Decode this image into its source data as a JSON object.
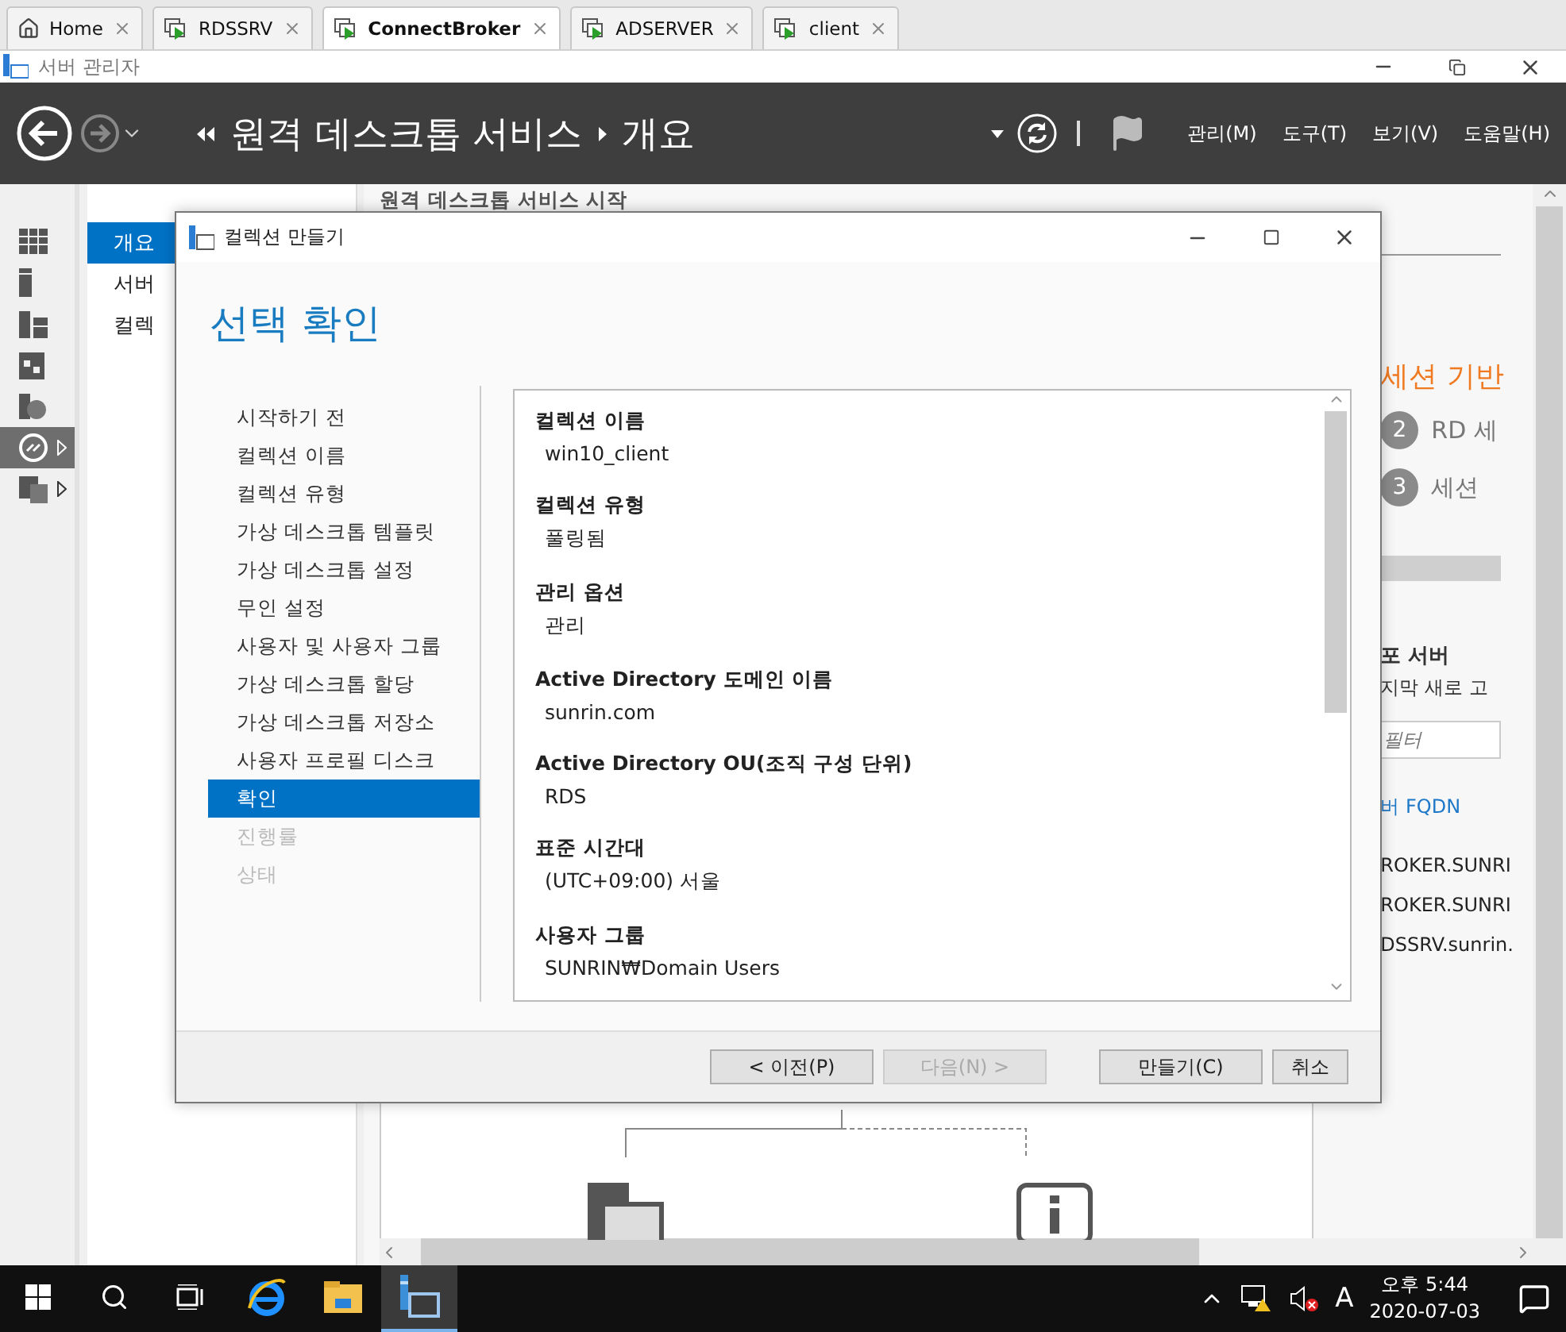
{
  "browser_tabs": [
    {
      "label": "Home",
      "kind": "home",
      "selected": false
    },
    {
      "label": "RDSSRV",
      "kind": "vm",
      "selected": false
    },
    {
      "label": "ConnectBroker",
      "kind": "vm",
      "selected": true
    },
    {
      "label": "ADSERVER",
      "kind": "vm",
      "selected": false
    },
    {
      "label": "client",
      "kind": "vm",
      "selected": false
    }
  ],
  "window": {
    "title": "서버 관리자"
  },
  "header": {
    "breadcrumb": [
      "원격 데스크톱 서비스",
      "개요"
    ],
    "menus": [
      "관리(M)",
      "도구(T)",
      "보기(V)",
      "도움말(H)"
    ]
  },
  "icon_rail": [
    {
      "kind": "dashboard",
      "selected": false,
      "expandable": false
    },
    {
      "kind": "server",
      "selected": false,
      "expandable": false
    },
    {
      "kind": "servers",
      "selected": false,
      "expandable": false
    },
    {
      "kind": "building",
      "selected": false,
      "expandable": false
    },
    {
      "kind": "web",
      "selected": false,
      "expandable": false
    },
    {
      "kind": "remote",
      "selected": true,
      "expandable": true
    },
    {
      "kind": "storage",
      "selected": false,
      "expandable": true
    }
  ],
  "nav": [
    {
      "label": "개요",
      "selected": true
    },
    {
      "label": "서버",
      "selected": false
    },
    {
      "label": "컬렉",
      "selected": false
    }
  ],
  "content": {
    "heading": "원격 데스크톱 서비스 시작",
    "deployment_title": "세션 기반",
    "steps": [
      {
        "number": "2",
        "label": "RD 세"
      },
      {
        "number": "3",
        "label": "세션"
      }
    ],
    "servers_title": "포 서버",
    "servers_subtitle": "지막 새로 고",
    "filter_placeholder": "필터",
    "column": "버 FQDN",
    "rows": [
      "ROKER.SUNRI",
      "ROKER.SUNRI",
      "DSSRV.sunrin."
    ]
  },
  "dialog": {
    "title": "컬렉션 만들기",
    "heading": "선택 확인",
    "steps": [
      {
        "label": "시작하기 전",
        "selected": false,
        "disabled": false
      },
      {
        "label": "컬렉션 이름",
        "selected": false,
        "disabled": false
      },
      {
        "label": "컬렉션 유형",
        "selected": false,
        "disabled": false
      },
      {
        "label": "가상 데스크톱 템플릿",
        "selected": false,
        "disabled": false
      },
      {
        "label": "가상 데스크톱 설정",
        "selected": false,
        "disabled": false
      },
      {
        "label": "무인 설정",
        "selected": false,
        "disabled": false
      },
      {
        "label": "사용자 및 사용자 그룹",
        "selected": false,
        "disabled": false
      },
      {
        "label": "가상 데스크톱 할당",
        "selected": false,
        "disabled": false
      },
      {
        "label": "가상 데스크톱 저장소",
        "selected": false,
        "disabled": false
      },
      {
        "label": "사용자 프로필 디스크",
        "selected": false,
        "disabled": false
      },
      {
        "label": "확인",
        "selected": true,
        "disabled": false
      },
      {
        "label": "진행률",
        "selected": false,
        "disabled": true
      },
      {
        "label": "상태",
        "selected": false,
        "disabled": true
      }
    ],
    "summary": [
      {
        "label": "컬렉션 이름",
        "value": "win10_client"
      },
      {
        "label": "컬렉션 유형",
        "value": "풀링됨"
      },
      {
        "label": "관리 옵션",
        "value": "관리"
      },
      {
        "label": "Active Directory 도메인 이름",
        "value": "sunrin.com"
      },
      {
        "label": "Active Directory OU(조직 구성 단위)",
        "value": "RDS"
      },
      {
        "label": "표준 시간대",
        "value": "(UTC+09:00) 서울"
      },
      {
        "label": "사용자 그룹",
        "value": "SUNRIN₩Domain Users"
      }
    ],
    "buttons": [
      {
        "label": "< 이전(P)",
        "disabled": false
      },
      {
        "label": "다음(N) >",
        "disabled": true
      },
      {
        "label": "만들기(C)",
        "disabled": false
      },
      {
        "label": "취소",
        "disabled": false
      }
    ]
  },
  "taskbar": {
    "apps": [
      {
        "kind": "search",
        "selected": false
      },
      {
        "kind": "taskview",
        "selected": false
      },
      {
        "kind": "browser",
        "selected": false
      },
      {
        "kind": "folder",
        "selected": false
      },
      {
        "kind": "servermanager",
        "selected": true
      }
    ],
    "ime": "A",
    "time": "오후 5:44",
    "date": "2020-07-03"
  }
}
